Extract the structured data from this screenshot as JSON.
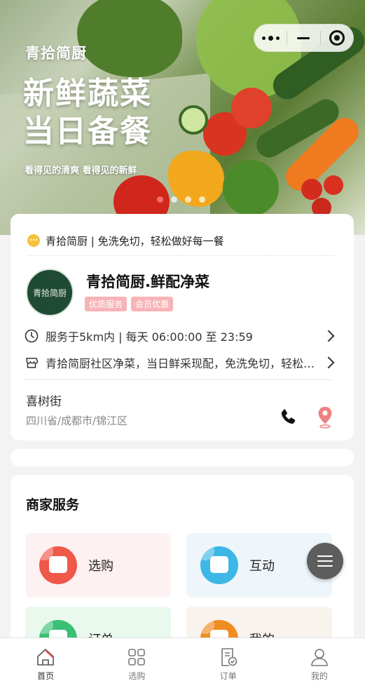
{
  "banner": {
    "brand": "青拾简厨",
    "headline_line1": "新鲜蔬菜",
    "headline_line2": "当日备餐",
    "subtitle": "看得见的清爽 看得见的新鲜",
    "carousel_count": 4,
    "carousel_active": 1,
    "accent_color": "#f56f6f"
  },
  "capsule": {
    "icons": [
      "more-icon",
      "minimize-icon",
      "close-target-icon"
    ]
  },
  "store": {
    "notice": "青拾简厨 | 免洗免切，轻松做好每一餐",
    "logo_text": "青拾简厨",
    "name": "青拾简厨.鲜配净菜",
    "tags": [
      "优质服务",
      "会员优惠"
    ],
    "hours": "服务于5km内 | 每天 06:00:00 至 23:59",
    "intro": "青拾简厨社区净菜，当日鲜采现配，免洗免切，轻松做好每一餐",
    "street": "喜树街",
    "region": "四川省/成都市/锦江区",
    "tag_color": "#f7b3b5"
  },
  "services": {
    "title": "商家服务",
    "items": [
      {
        "label": "选购",
        "icon": "shopping-bag-icon",
        "color": "#f0584a"
      },
      {
        "label": "互动",
        "icon": "chat-face-icon",
        "color": "#3db7e6"
      },
      {
        "label": "订单",
        "icon": "order-icon",
        "color": "#39c074"
      },
      {
        "label": "我的",
        "icon": "user-icon",
        "color": "#f08d20"
      }
    ]
  },
  "tabbar": {
    "items": [
      {
        "label": "首页",
        "icon": "home-icon",
        "active": true
      },
      {
        "label": "选购",
        "icon": "grid-icon",
        "active": false
      },
      {
        "label": "订单",
        "icon": "order-doc-icon",
        "active": false
      },
      {
        "label": "我的",
        "icon": "person-icon",
        "active": false
      }
    ]
  }
}
